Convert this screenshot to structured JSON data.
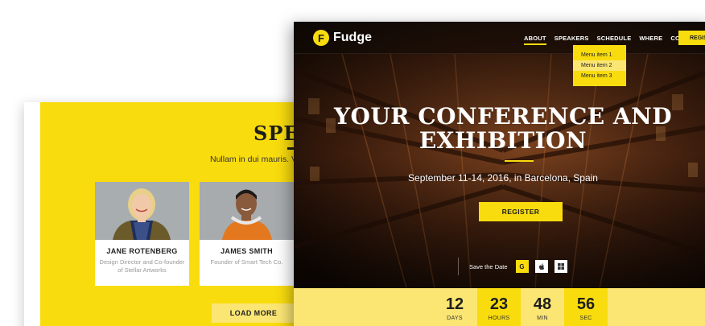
{
  "speakers_page": {
    "title": "SPEA",
    "subtitle": "Nullam in dui mauris. Viv",
    "speakers": [
      {
        "name": "JANE ROTENBERG",
        "role": "Design Director and Co-founder of Stellar Artworks"
      },
      {
        "name": "JAMES SMITH",
        "role": "Founder of Smart Tech Co."
      }
    ],
    "load_more_label": "LOAD MORE"
  },
  "hero_page": {
    "logo_letter": "F",
    "logo_text": "Fudge",
    "nav": [
      {
        "label": "ABOUT",
        "active": true
      },
      {
        "label": "SPEAKERS",
        "active": false
      },
      {
        "label": "SCHEDULE",
        "active": false
      },
      {
        "label": "WHERE",
        "active": false
      },
      {
        "label": "CONTACT",
        "active": false
      }
    ],
    "nav_cta_label": "REGIS",
    "dropdown": [
      "Menu item 1",
      "Menu item 2",
      "Menu item 3"
    ],
    "title_line1": "YOUR CONFERENCE AND",
    "title_line2": "EXHIBITION",
    "subtitle": "September 11-14, 2016, in Barcelona, Spain",
    "register_label": "REGISTER",
    "save_label": "Save the Date",
    "save_icons": [
      "google-icon",
      "apple-icon",
      "windows-icon"
    ],
    "save_google_glyph": "G",
    "countdown": [
      {
        "value": "12",
        "label": "DAYS"
      },
      {
        "value": "23",
        "label": "HOURS"
      },
      {
        "value": "48",
        "label": "MIN"
      },
      {
        "value": "56",
        "label": "SEC"
      }
    ]
  },
  "colors": {
    "accent": "#f9dc0e",
    "accent_light": "#fbe673",
    "dark": "#1d1d1d"
  }
}
